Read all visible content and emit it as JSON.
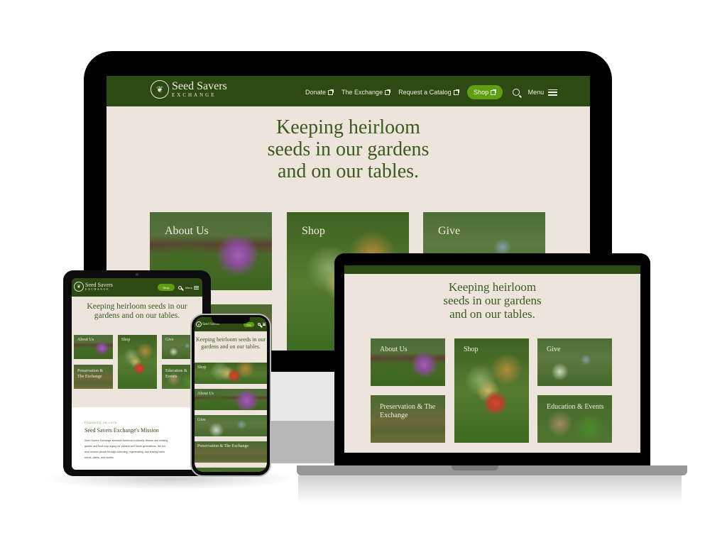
{
  "site": {
    "logo": {
      "line1": "Seed Savers",
      "line2": "EXCHANGE",
      "icon": "seed-hands-logo-icon"
    },
    "nav": [
      {
        "label": "Donate",
        "icon": "external-link-icon"
      },
      {
        "label": "The Exchange",
        "icon": "external-link-icon"
      },
      {
        "label": "Request a Catalog",
        "icon": "external-link-icon"
      }
    ],
    "shop_button": {
      "label": "Shop",
      "icon": "external-link-icon"
    },
    "search_icon": "search-icon",
    "menu": {
      "label": "Menu",
      "icon": "hamburger-icon"
    },
    "hero": {
      "lines": [
        "Keeping heirloom",
        "seeds in our gardens",
        "and on our tables."
      ],
      "single": "Keeping heirloom seeds in our gardens and on our tables."
    },
    "tiles": {
      "about": "About Us",
      "shop": "Shop",
      "give": "Give",
      "preservation": "Preservation & The Exchange",
      "preservation_short1": "Preservation &",
      "preservation_short2": "The Exchange",
      "education": "Education & Events",
      "education_short1": "Education &",
      "education_short2": "Events"
    },
    "mission": {
      "eyebrow": "FOUNDED IN 1975",
      "title": "Seed Savers Exchange's Mission",
      "body_lines": [
        "Seed Savers Exchange stewards America's culturally diverse and endang",
        "garden and food crop legacy for present and future generations. We em",
        "and connect people through collecting, regenerating, and sharing heirlo",
        "seeds, plants, and stories."
      ]
    }
  },
  "colors": {
    "header_green": "#2d4a12",
    "accent_green": "#5ea012",
    "body_cream": "#ede4dc",
    "heading_green": "#3a5a1e"
  }
}
